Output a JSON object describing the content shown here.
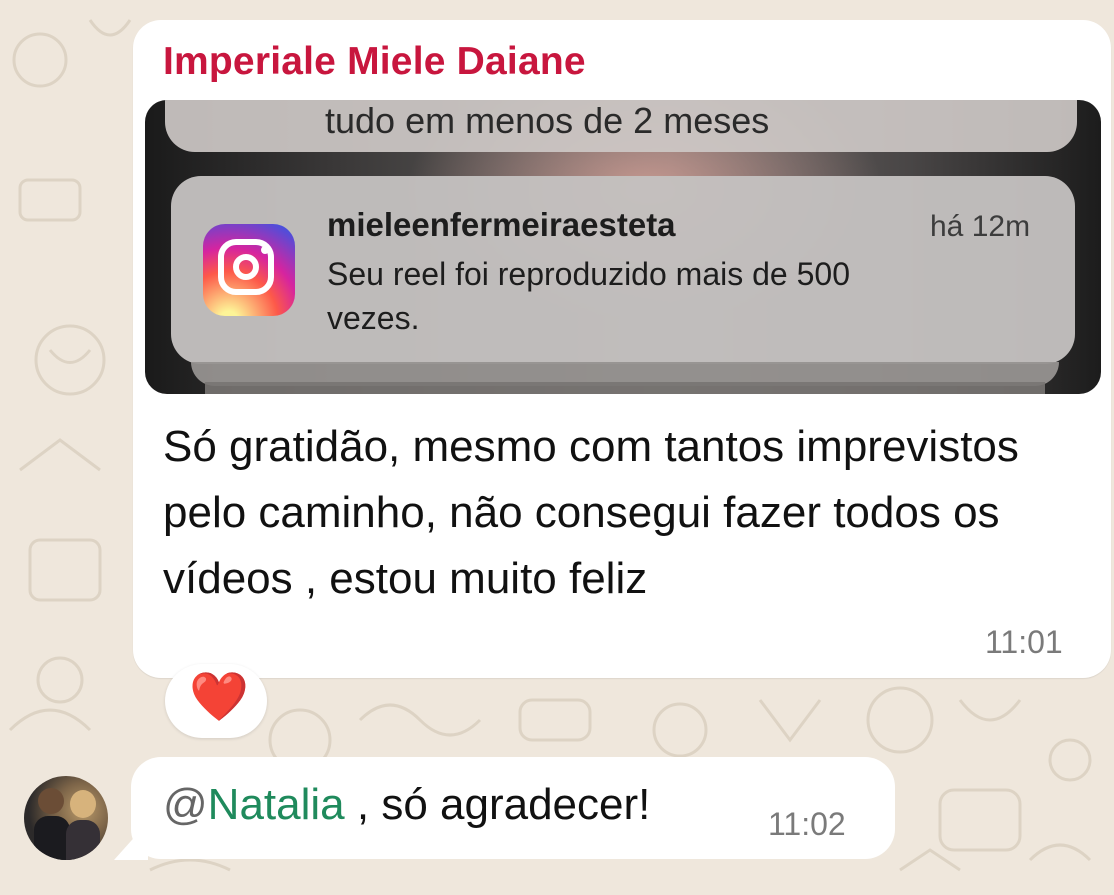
{
  "chat": {
    "message1": {
      "sender": "Imperiale Miele Daiane",
      "media": {
        "previous_notification_fragment": "tudo em menos de 2 meses",
        "notification": {
          "app_icon": "instagram-icon",
          "account": "mieleenfermeiraesteta",
          "time_ago": "há 12m",
          "body": "Seu reel foi reproduzido mais de 500 vezes."
        }
      },
      "text": "Só gratidão, mesmo com tantos imprevistos pelo caminho, não consegui fazer todos os vídeos , estou muito feliz",
      "time": "11:01",
      "reaction": "❤️"
    },
    "message2": {
      "mention_at": "@",
      "mention_name": "Natalia",
      "text": " , só agradecer!",
      "time": "11:02",
      "avatar": "avatar-photo"
    }
  },
  "colors": {
    "sender_name": "#c8163e",
    "mention": "#1f8a5c",
    "timestamp": "#7a7a7a",
    "bubble": "#ffffff",
    "wallpaper": "#efe7dc"
  }
}
